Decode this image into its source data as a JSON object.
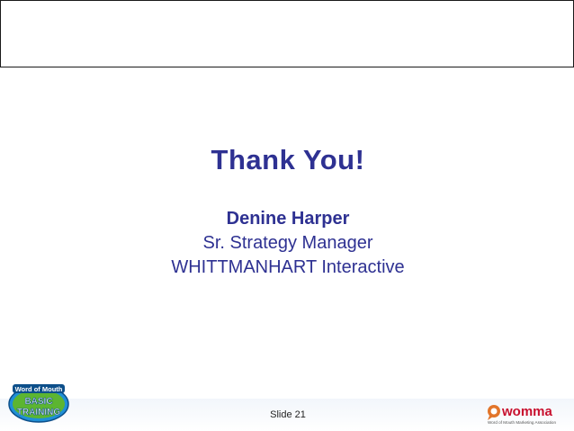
{
  "slide": {
    "title": "Thank You!",
    "presenter_name": "Denine Harper",
    "presenter_role": "Sr. Strategy Manager",
    "presenter_company": "WHITTMANHART Interactive",
    "slide_number": "Slide 21"
  },
  "logos": {
    "badge_line1": "Word of Mouth",
    "badge_line2": "BASIC",
    "badge_line3": "TRAINING",
    "womma_name": "womma",
    "womma_tagline": "Word of Mouth Marketing Association"
  },
  "colors": {
    "title_blue": "#2e3192",
    "badge_green": "#5cb531",
    "badge_blue": "#1f8fd6",
    "womma_orange": "#e2752a",
    "womma_red": "#c8102e"
  }
}
